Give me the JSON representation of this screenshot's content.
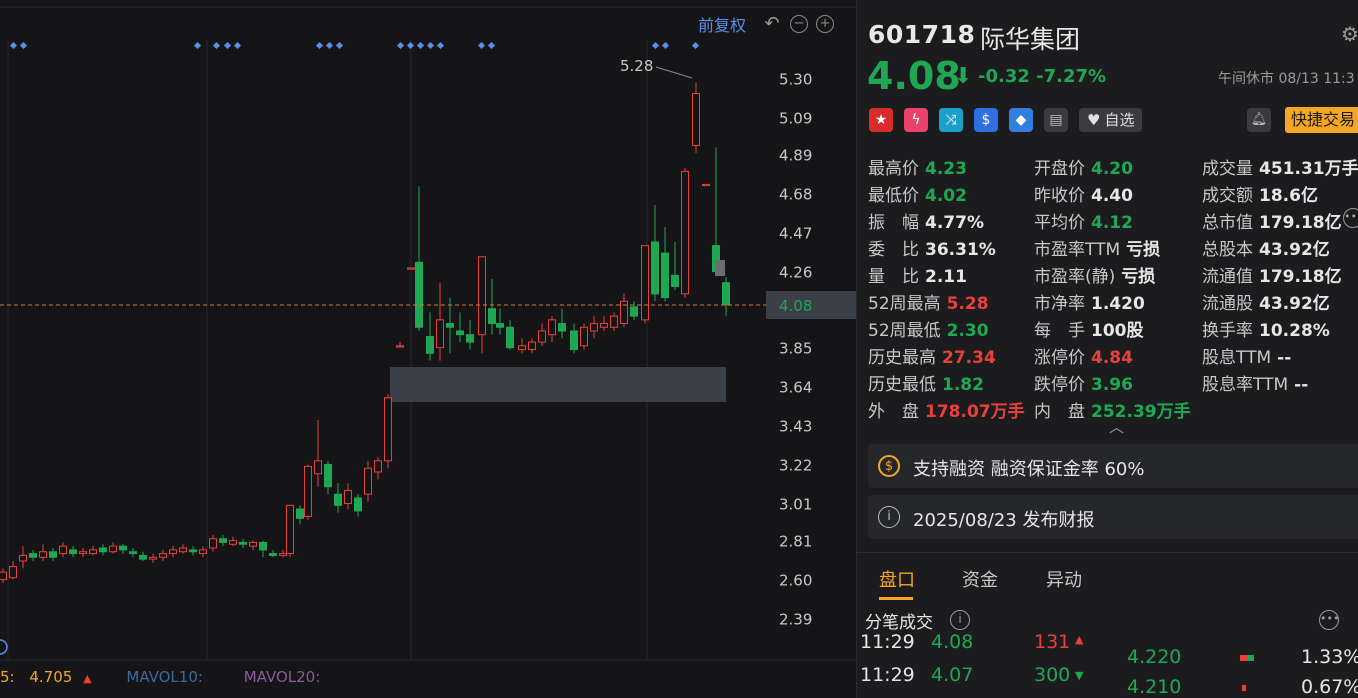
{
  "chart": {
    "fq_label": "前复权",
    "y_ticks": [
      "5.30",
      "5.09",
      "4.89",
      "4.68",
      "4.47",
      "4.26",
      "4.08",
      "3.85",
      "3.64",
      "3.43",
      "3.22",
      "3.01",
      "2.81",
      "2.60",
      "2.39"
    ],
    "current_price_label": "4.08",
    "high_annotation": "5.28",
    "mavol": {
      "ma5_label": "5:",
      "ma5_value": "4.705",
      "ma10_label": "MAVOL10:",
      "ma20_label": "MAVOL20:"
    },
    "colors": {
      "up": "#e8413b",
      "down": "#1fa854",
      "price_line": "#e07a2e",
      "marker": "#5b8ee8"
    }
  },
  "stock": {
    "code": "601718",
    "name": "际华集团",
    "price": "4.08",
    "change": "-0.32",
    "change_pct": "-7.27%",
    "status": "午间休市 08/13 11:3",
    "zixuan_label": "自选",
    "quick_trade": "快捷交易"
  },
  "stats": [
    [
      {
        "label": "最高价",
        "value": "4.23",
        "c": "g"
      },
      {
        "label": "开盘价",
        "value": "4.20",
        "c": "g"
      },
      {
        "label": "成交量",
        "value": "451.31万手",
        "c": "w"
      }
    ],
    [
      {
        "label": "最低价",
        "value": "4.02",
        "c": "g"
      },
      {
        "label": "昨收价",
        "value": "4.40",
        "c": "w"
      },
      {
        "label": "成交额",
        "value": "18.6亿",
        "c": "w"
      }
    ],
    [
      {
        "label": "振　幅",
        "value": "4.77%",
        "c": "w"
      },
      {
        "label": "平均价",
        "value": "4.12",
        "c": "g"
      },
      {
        "label": "总市值",
        "value": "179.18亿",
        "c": "w"
      }
    ],
    [
      {
        "label": "委　比",
        "value": "36.31%",
        "c": "w"
      },
      {
        "label": "市盈率TTM",
        "value": "亏损",
        "c": "w"
      },
      {
        "label": "总股本",
        "value": "43.92亿",
        "c": "w"
      }
    ],
    [
      {
        "label": "量　比",
        "value": "2.11",
        "c": "w"
      },
      {
        "label": "市盈率(静)",
        "value": "亏损",
        "c": "w"
      },
      {
        "label": "流通值",
        "value": "179.18亿",
        "c": "w"
      }
    ],
    [
      {
        "label": "52周最高",
        "value": "5.28",
        "c": "r"
      },
      {
        "label": "市净率",
        "value": "1.420",
        "c": "w"
      },
      {
        "label": "流通股",
        "value": "43.92亿",
        "c": "w"
      }
    ],
    [
      {
        "label": "52周最低",
        "value": "2.30",
        "c": "g"
      },
      {
        "label": "每　手",
        "value": "100股",
        "c": "w"
      },
      {
        "label": "换手率",
        "value": "10.28%",
        "c": "w"
      }
    ],
    [
      {
        "label": "历史最高",
        "value": "27.34",
        "c": "r"
      },
      {
        "label": "涨停价",
        "value": "4.84",
        "c": "r"
      },
      {
        "label": "股息TTM",
        "value": "--",
        "c": "w"
      }
    ],
    [
      {
        "label": "历史最低",
        "value": "1.82",
        "c": "g"
      },
      {
        "label": "跌停价",
        "value": "3.96",
        "c": "g"
      },
      {
        "label": "股息率TTM",
        "value": "--",
        "c": "w"
      }
    ],
    [
      {
        "label": "外　盘",
        "value": "178.07万手",
        "c": "r"
      },
      {
        "label": "内　盘",
        "value": "252.39万手",
        "c": "g"
      }
    ]
  ],
  "cards": {
    "margin": "支持融资 融资保证金率 60%",
    "report": "2025/08/23  发布财报"
  },
  "tabs": [
    "盘口",
    "资金",
    "异动"
  ],
  "trades_title": "分笔成交",
  "trades": [
    {
      "time": "11:29",
      "price": "4.08",
      "vol": "131"
    },
    {
      "time": "11:29",
      "price": "4.07",
      "vol": "300"
    }
  ],
  "book": [
    {
      "price": "4.220",
      "pct": "1.33%"
    },
    {
      "price": "4.210",
      "pct": "0.67%"
    }
  ]
}
